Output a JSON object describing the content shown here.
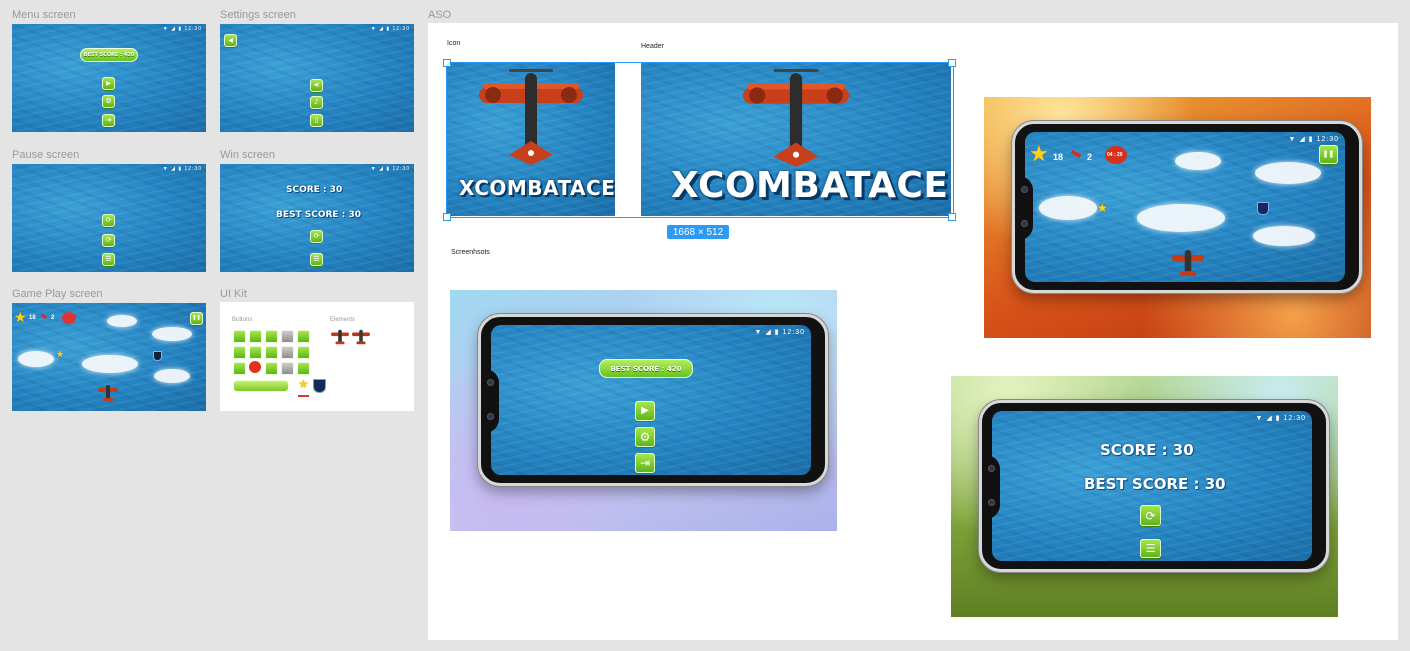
{
  "frames": {
    "menu": "Menu screen",
    "settings": "Settings screen",
    "pause": "Pause screen",
    "win": "Win screen",
    "gameplay": "Game Play screen",
    "uikit": "UI Kit",
    "aso": "ASO"
  },
  "status_bar": "▼ ◢ ▮ 12:30",
  "best_score_pill": "BEST SCORE : 420",
  "win": {
    "score": "SCORE : 30",
    "best": "BEST SCORE : 30"
  },
  "hud": {
    "stars": "18",
    "rockets": "2",
    "bomb": "04 : 20"
  },
  "kit": {
    "buttons": "Buttons",
    "elements": "Elements"
  },
  "aso": {
    "icon_label": "Icon",
    "header_label": "Header",
    "screenshots_label": "Screenhsots",
    "game_title": "XCOMBATACE",
    "dimension_badge": "1668 × 512"
  },
  "icons": {
    "play": "▶",
    "gear": "⚙",
    "exit": "⇥",
    "back": "◀",
    "sound": "◀)",
    "music": "♪",
    "vibrate": "▯",
    "restart": "⟳",
    "list": "☰",
    "pause": "❚❚",
    "star": "★"
  },
  "colors": {
    "accent_green": "#7ccf2c",
    "selection_blue": "#2a9af4",
    "water": "#2484c2"
  }
}
